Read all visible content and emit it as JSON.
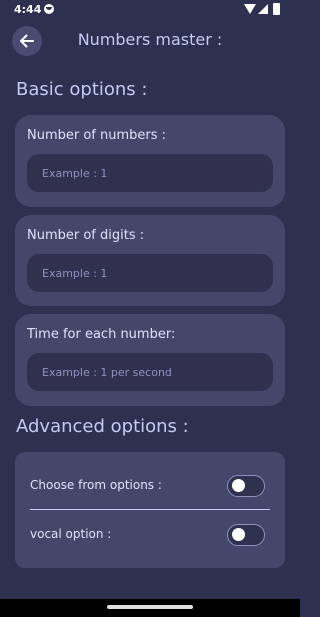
{
  "status_bar": {
    "time": "4:44"
  },
  "header": {
    "title": "Numbers master :"
  },
  "basic": {
    "title": "Basic options :",
    "fields": [
      {
        "label": "Number of numbers :",
        "placeholder": "Example : 1"
      },
      {
        "label": "Number of digits :",
        "placeholder": "Example : 1"
      },
      {
        "label": "Time for each number:",
        "placeholder": "Example : 1 per second"
      }
    ]
  },
  "advanced": {
    "title": "Advanced options :",
    "options": [
      {
        "label": "Choose from options :",
        "enabled": false
      },
      {
        "label": "vocal option :",
        "enabled": false
      }
    ]
  },
  "colors": {
    "background": "#2e3050",
    "card": "#45476a",
    "input": "#2f314f",
    "accent_text": "#c5caf3"
  }
}
